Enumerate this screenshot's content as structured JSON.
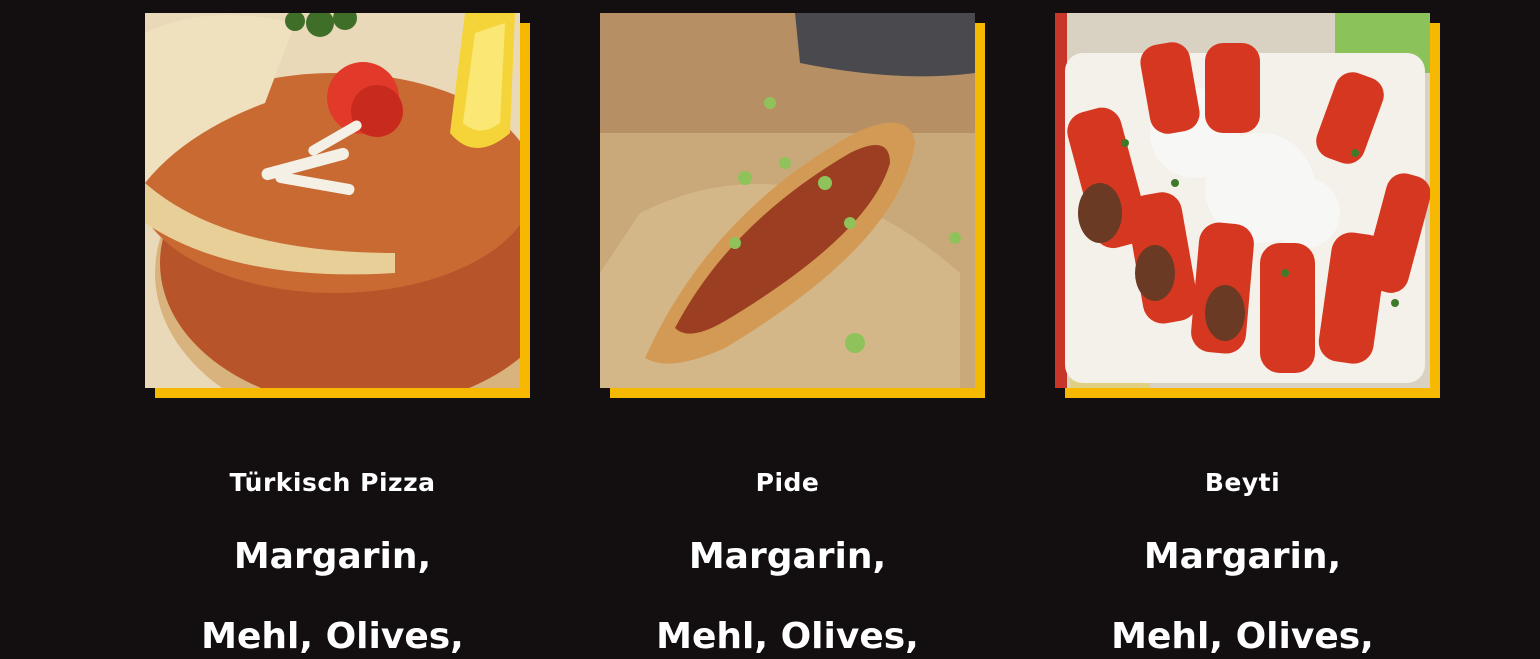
{
  "items": [
    {
      "name": "Türkisch Pizza",
      "description_line1": "Margarin,",
      "description_line2": "Mehl, Olives,"
    },
    {
      "name": "Pide",
      "description_line1": "Margarin,",
      "description_line2": "Mehl, Olives,"
    },
    {
      "name": "Beyti",
      "description_line1": "Margarin,",
      "description_line2": "Mehl, Olives,"
    }
  ],
  "colors": {
    "background": "#130e0f",
    "accent": "#f6b800",
    "text": "#ffffff"
  }
}
